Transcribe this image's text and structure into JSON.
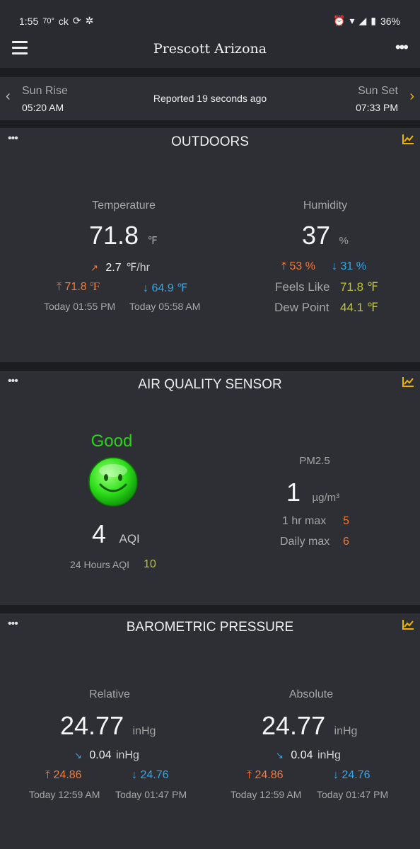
{
  "status_bar": {
    "time": "1:55",
    "temp": "70°",
    "carrier": "ck",
    "battery": "36%",
    "icons": [
      "sync-icon",
      "pinwheel-icon",
      "alarm-icon",
      "wifi-icon",
      "signal-icon",
      "battery-icon"
    ]
  },
  "app_bar": {
    "title": "Prescott Arizona",
    "menu_icon": "hamburger-icon",
    "more_icon": "more-dots-icon"
  },
  "sun": {
    "rise_label": "Sun Rise",
    "rise_time": "05:20 AM",
    "set_label": "Sun Set",
    "set_time": "07:33 PM",
    "reported": "Reported 19 seconds ago"
  },
  "outdoors": {
    "title": "OUTDOORS",
    "temperature": {
      "label": "Temperature",
      "value": "71.8",
      "unit": "℉",
      "rate_value": "2.7",
      "rate_unit": "℉/hr",
      "high": "71.8 ℉",
      "low": "64.9 ℉",
      "high_time": "Today 01:55 PM",
      "low_time": "Today 05:58 AM"
    },
    "humidity": {
      "label": "Humidity",
      "value": "37",
      "unit": "%",
      "high": "53 %",
      "low": "31 %",
      "feels_like_label": "Feels Like",
      "feels_like": "71.8 ℉",
      "dew_point_label": "Dew Point",
      "dew_point": "44.1 ℉"
    }
  },
  "air_quality": {
    "title": "AIR QUALITY SENSOR",
    "status": "Good",
    "aqi_value": "4",
    "aqi_unit": "AQI",
    "aqi24_label": "24 Hours AQI",
    "aqi24_value": "10",
    "pm_label": "PM2.5",
    "pm_value": "1",
    "pm_unit": "µg/m³",
    "hr_max_label": "1 hr max",
    "hr_max": "5",
    "daily_max_label": "Daily max",
    "daily_max": "6"
  },
  "pressure": {
    "title": "BAROMETRIC PRESSURE",
    "relative": {
      "label": "Relative",
      "value": "24.77",
      "unit": "inHg",
      "rate_value": "0.04",
      "rate_unit": "inHg",
      "high": "24.86",
      "low": "24.76",
      "high_time": "Today 12:59 AM",
      "low_time": "Today 01:47 PM"
    },
    "absolute": {
      "label": "Absolute",
      "value": "24.77",
      "unit": "inHg",
      "rate_value": "0.04",
      "rate_unit": "inHg",
      "high": "24.86",
      "low": "24.76",
      "high_time": "Today 12:59 AM",
      "low_time": "Today 01:47 PM"
    }
  },
  "colors": {
    "accent": "#f0b400",
    "high": "#f07a3c",
    "low": "#35a6e8",
    "good": "#2bd31b",
    "olive": "#bcc13a"
  }
}
